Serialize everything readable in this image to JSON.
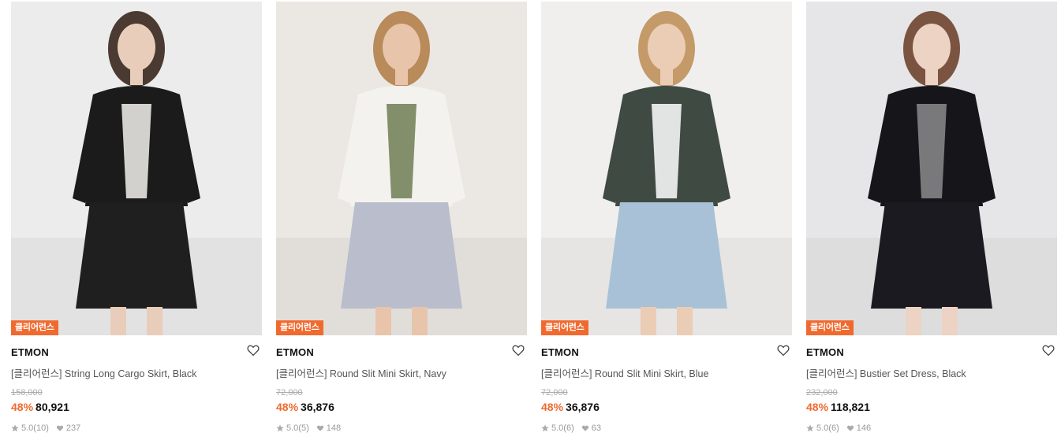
{
  "colors": {
    "accent": "#f06a2f",
    "badge": "#f06a2f"
  },
  "products": [
    {
      "badge": "클리어런스",
      "brand": "ETMON",
      "title": "[클리어런스] String Long Cargo Skirt, Black",
      "original_price": "158,000",
      "discount": "48%",
      "price": "80,921",
      "rating": "5.0",
      "reviews": "(10)",
      "likes": "237",
      "photo": {
        "bg": "#ececec",
        "top": "#1b1b1b",
        "bottom": "#1f1f1f",
        "accent": "#f3f1ec",
        "hair": "#4a3a32",
        "skin": "#e9cdbb"
      }
    },
    {
      "badge": "클리어런스",
      "brand": "ETMON",
      "title": "[클리어런스] Round Slit Mini Skirt, Navy",
      "original_price": "72,000",
      "discount": "48%",
      "price": "36,876",
      "rating": "5.0",
      "reviews": "(5)",
      "likes": "148",
      "photo": {
        "bg": "#ebe8e3",
        "top": "#f4f2ee",
        "bottom": "#b9bdcc",
        "accent": "#6e7e54",
        "hair": "#b98a5a",
        "skin": "#e8c4ab"
      }
    },
    {
      "badge": "클리어런스",
      "brand": "ETMON",
      "title": "[클리어런스] Round Slit Mini Skirt, Blue",
      "original_price": "72,000",
      "discount": "48%",
      "price": "36,876",
      "rating": "5.0",
      "reviews": "(6)",
      "likes": "63",
      "photo": {
        "bg": "#f0efed",
        "top": "#3f4a42",
        "bottom": "#a9c1d6",
        "accent": "#ffffff",
        "hair": "#c39a68",
        "skin": "#ebccb5"
      }
    },
    {
      "badge": "클리어런스",
      "brand": "ETMON",
      "title": "[클리어런스] Bustier Set Dress, Black",
      "original_price": "232,000",
      "discount": "48%",
      "price": "118,821",
      "rating": "5.0",
      "reviews": "(6)",
      "likes": "146",
      "photo": {
        "bg": "#e6e6e8",
        "top": "#15151a",
        "bottom": "#1a1a20",
        "accent": "#8b8b8e",
        "hair": "#7a5440",
        "skin": "#ecd3c3"
      }
    }
  ]
}
